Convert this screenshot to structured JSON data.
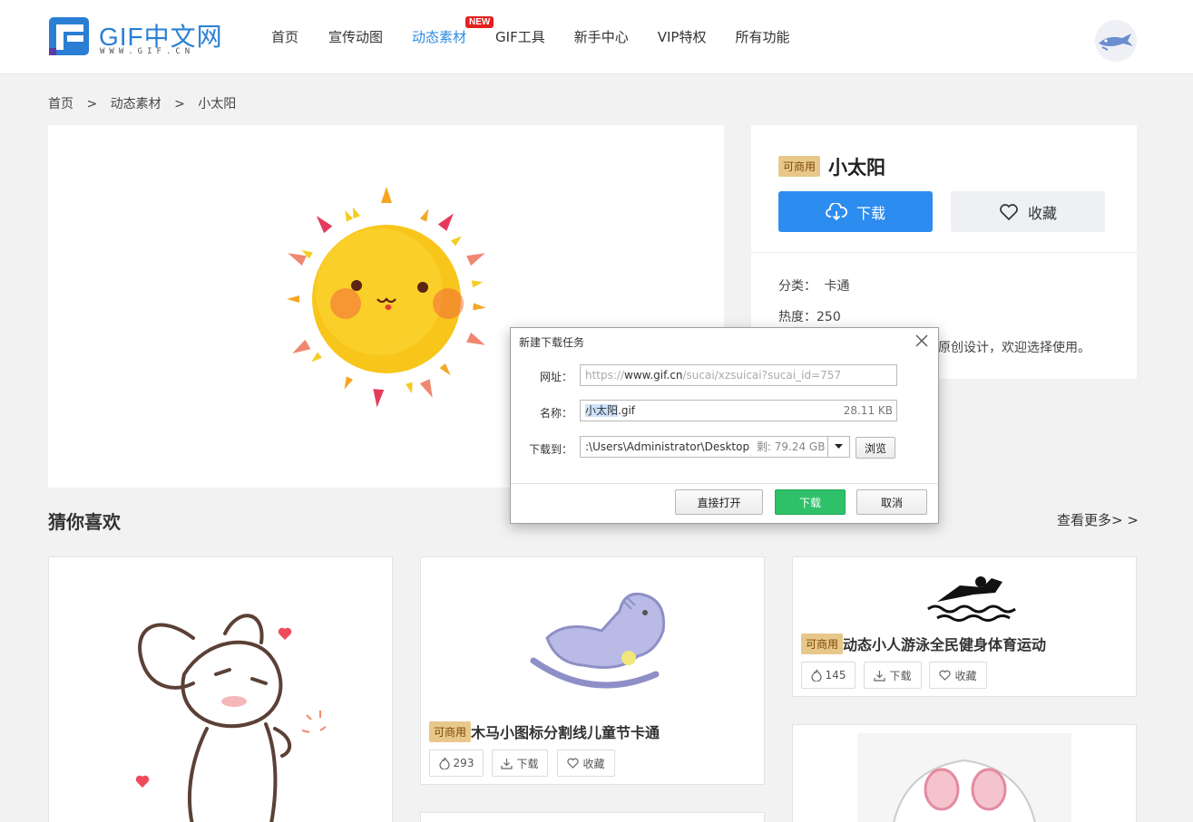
{
  "header": {
    "logo_text": "GIF中文网",
    "logo_sub": "WWW.GIF.CN",
    "nav": [
      "首页",
      "宣传动图",
      "动态素材",
      "GIF工具",
      "新手中心",
      "VIP特权",
      "所有功能"
    ],
    "active_nav": "动态素材",
    "new_badge": "NEW"
  },
  "breadcrumb": [
    "首页",
    ">",
    "动态素材",
    ">",
    "小太阳"
  ],
  "detail": {
    "tag": "可商用",
    "title": "小太阳",
    "download_label": "下载",
    "favorite_label": "收藏",
    "category_label": "分类：",
    "category_value": "卡通",
    "heat_label": "热度：",
    "heat_value": "250",
    "desc_tail": "原创设计，欢迎选择使用。"
  },
  "section": {
    "title": "猜你喜欢",
    "more": "查看更多> >"
  },
  "cards": [
    {
      "tag": "可商用",
      "title": "木马小图标分割线儿童节卡通",
      "heat": "293",
      "download": "下载",
      "favorite": "收藏"
    },
    {
      "tag": "可商用",
      "title": "动态小人游泳全民健身体育运动",
      "heat": "145",
      "download": "下载",
      "favorite": "收藏"
    }
  ],
  "dialog": {
    "title": "新建下载任务",
    "url_label": "网址：",
    "url_prefix": "https://",
    "url_host": "www.gif.cn",
    "url_path": "/sucai/xzsuicai?sucai_id=757",
    "name_label": "名称：",
    "name_selected": "小太阳",
    "name_ext": ".gif",
    "file_size": "28.11 KB",
    "dest_label": "下载到：",
    "dest_path": ":\\Users\\Administrator\\Desktop",
    "free_space": "剩: 79.24 GB",
    "browse": "浏览",
    "open_direct": "直接打开",
    "download": "下载",
    "cancel": "取消"
  },
  "colors": {
    "accent": "#2d8cf0",
    "active_nav": "#2a8de6",
    "tag_bg": "#e8c88a",
    "dialog_ok": "#2fc16a",
    "badge_red": "#e4201f"
  }
}
